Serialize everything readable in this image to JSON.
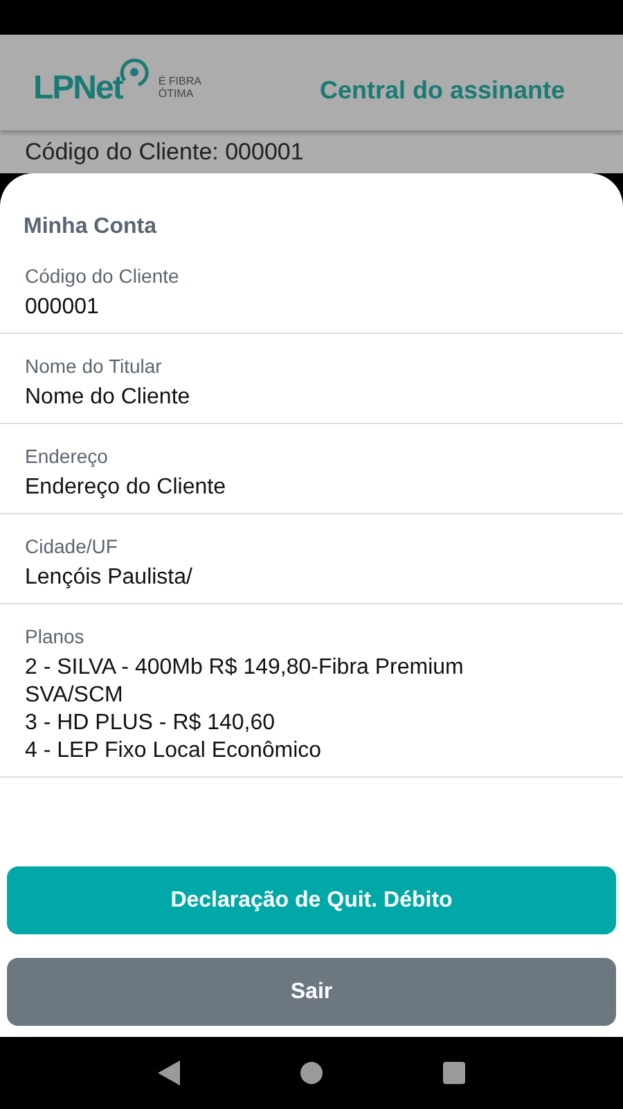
{
  "header": {
    "logo": {
      "brand": "LPNet",
      "tagline_1": "É FIBRA",
      "tagline_2": "ÓTIMA"
    },
    "title": "Central do assinante"
  },
  "background_text": "Código do Cliente: 000001",
  "sheet": {
    "title": "Minha Conta",
    "fields": [
      {
        "label": "Código do Cliente",
        "lines": [
          "000001"
        ]
      },
      {
        "label": "Nome do Titular",
        "lines": [
          "Nome do Cliente"
        ]
      },
      {
        "label": "Endereço",
        "lines": [
          "Endereço do Cliente"
        ]
      },
      {
        "label": "Cidade/UF",
        "lines": [
          "Lençóis Paulista/"
        ]
      },
      {
        "label": "Planos",
        "lines": [
          "2 - SILVA - 400Mb R$ 149,80-Fibra Premium SVA/SCM",
          "3 - HD PLUS - R$ 140,60",
          "4 - LEP Fixo Local Econômico"
        ]
      }
    ],
    "buttons": [
      {
        "label": "Declaração de Quit. Débito",
        "kind": "primary"
      },
      {
        "label": "Sair",
        "kind": "secondary"
      }
    ]
  }
}
